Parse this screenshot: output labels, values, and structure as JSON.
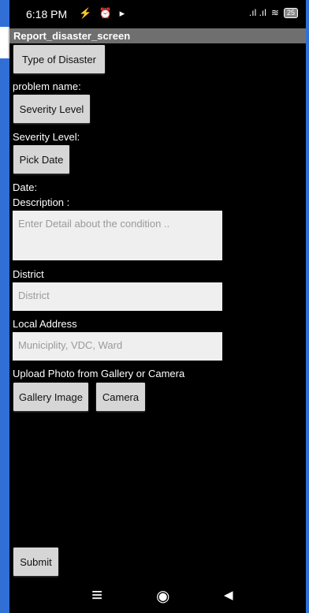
{
  "status_bar": {
    "time": "6:18 PM",
    "left_icons": "⚡ ⏰ ▸",
    "signal": ".ıl .ıl",
    "wifi": "≋",
    "battery": "25"
  },
  "app_bar": {
    "title": "Report_disaster_screen"
  },
  "form": {
    "type_button": "Type of Disaster",
    "problem_label": "problem name:",
    "severity_button": "Severity Level",
    "severity_label": "Severity Level:",
    "date_button": "Pick Date",
    "date_label": "Date:",
    "description_label": "Description :",
    "description_placeholder": "Enter Detail about the condition ..",
    "district_label": "District",
    "district_placeholder": "District",
    "address_label": "Local Address",
    "address_placeholder": "Municiplity, VDC, Ward",
    "upload_label": "Upload Photo from Gallery or Camera",
    "gallery_button": "Gallery Image",
    "camera_button": "Camera",
    "submit_button": "Submit"
  },
  "nav": {
    "menu": "≡",
    "home": "◉",
    "back": "◀"
  }
}
